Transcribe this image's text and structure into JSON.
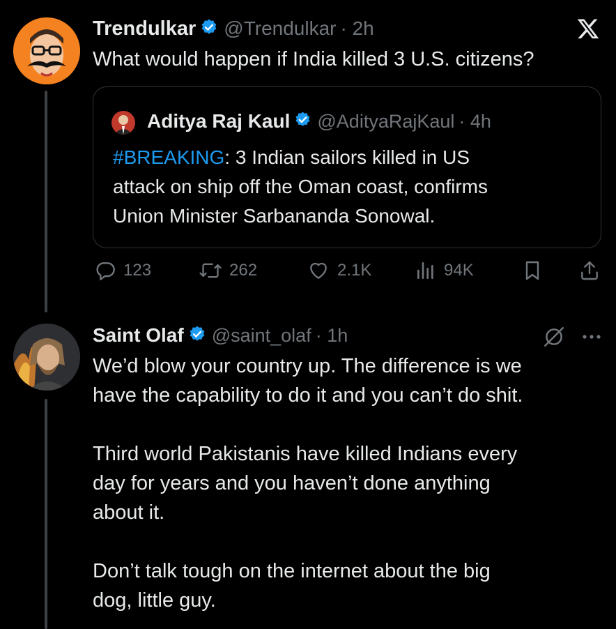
{
  "tweet": {
    "author_name": "Trendulkar",
    "handle": "@Trendulkar",
    "time": "· 2h",
    "text": "What would happen if India killed 3 U.S. citizens?"
  },
  "quoted": {
    "author_name": "Aditya Raj Kaul",
    "handle": "@AdityaRajKaul",
    "time": "· 4h",
    "hashtag": "#BREAKING",
    "text_rest": ": 3 Indian sailors killed in US",
    "line2": "attack on ship off the Oman coast, confirms",
    "line3": "Union Minister Sarbananda Sonowal."
  },
  "actions": {
    "replies": "123",
    "reposts": "262",
    "likes": "2.1K",
    "views": "94K"
  },
  "reply": {
    "author_name": "Saint Olaf",
    "handle": "@saint_olaf",
    "time": "· 1h",
    "paragraphs": [
      [
        "We’d blow your country up. The difference is we",
        "have the capability to do it and you can’t do shit."
      ],
      [
        "Third world Pakistanis have killed Indians every",
        "day for years and you haven’t done anything",
        "about it."
      ],
      [
        "Don’t talk tough on the internet about the big",
        "dog, little guy."
      ]
    ]
  },
  "icons": {
    "verified": "verified-badge-icon",
    "x_logo": "x-logo-icon",
    "more": "more-options-icon",
    "hidden": "hidden-reply-icon",
    "reply": "reply-icon",
    "repost": "repost-icon",
    "like": "like-icon",
    "views": "views-icon",
    "bookmark": "bookmark-icon",
    "share": "share-icon"
  },
  "colors": {
    "background": "#000000",
    "text": "#e7e9ea",
    "muted": "#71767b",
    "accent": "#1d9bf0",
    "border": "#2f3336"
  }
}
